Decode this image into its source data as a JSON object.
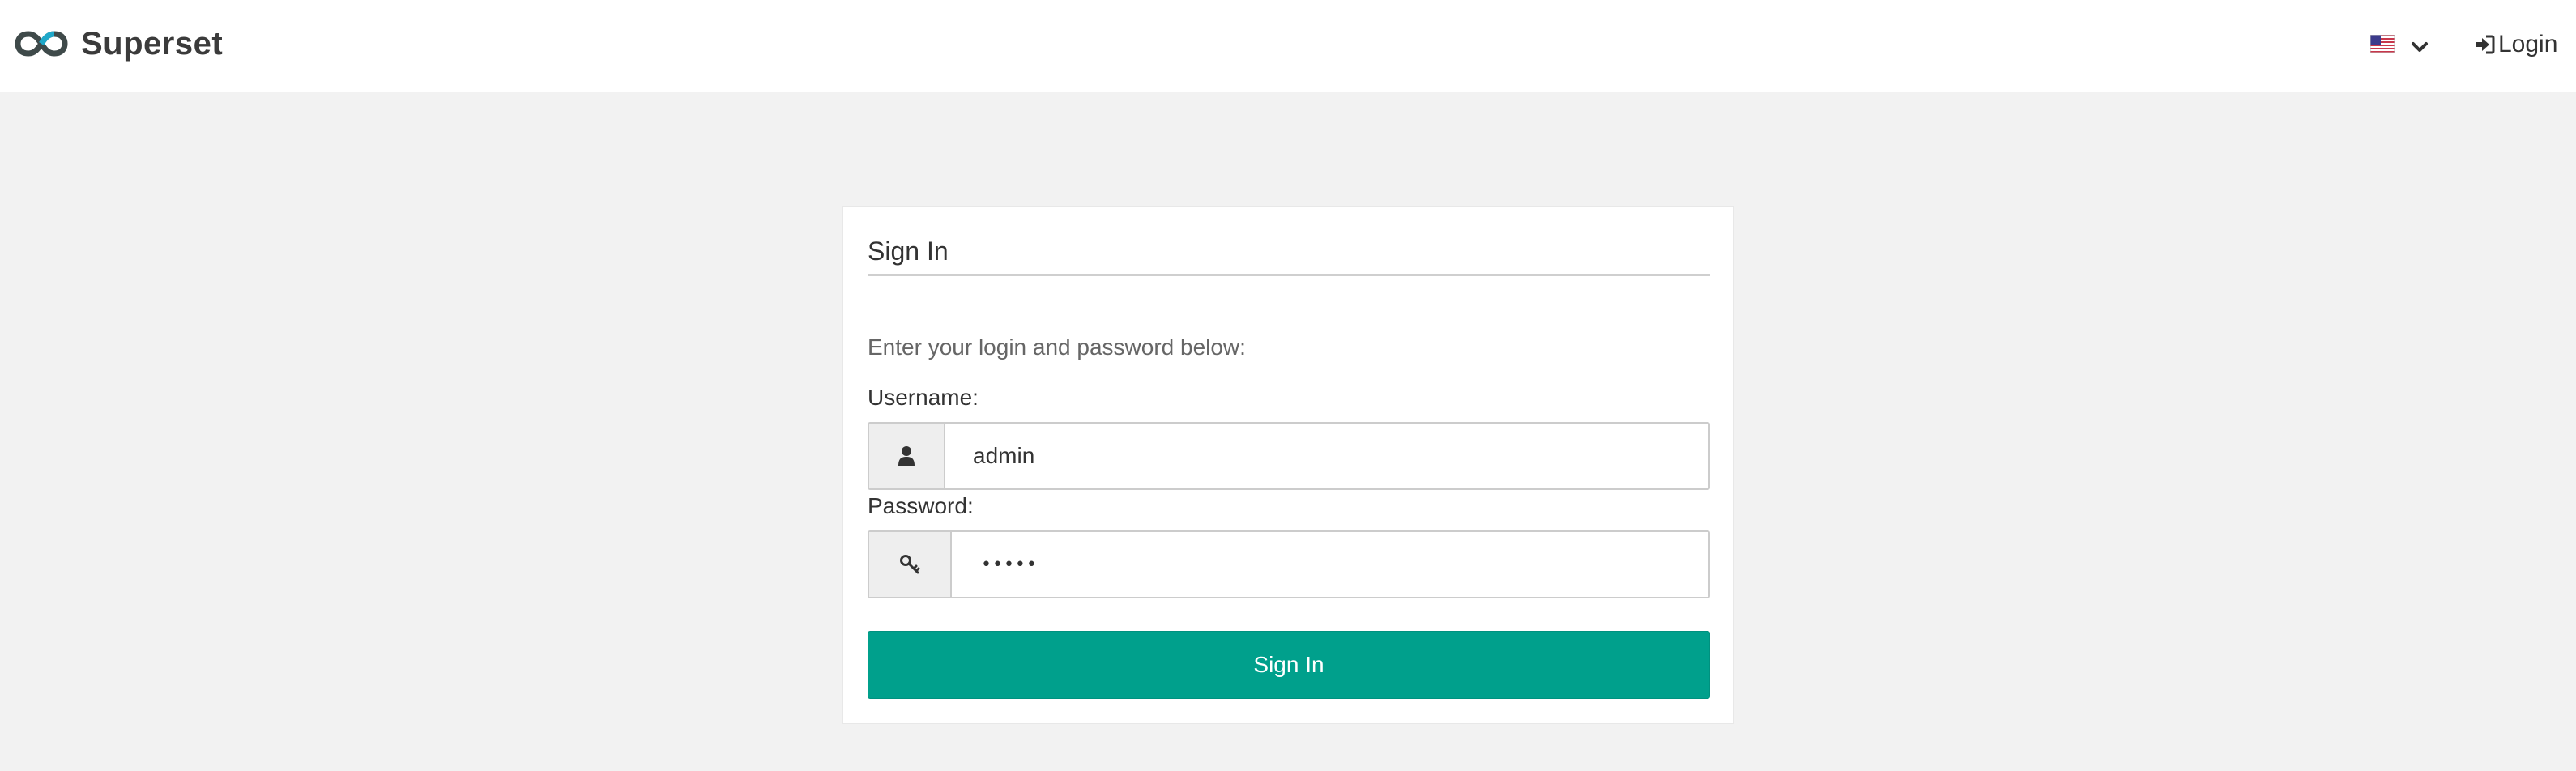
{
  "brand": {
    "name": "Superset",
    "logo_icon": "superset-logo-icon"
  },
  "navbar": {
    "language": {
      "icon": "us-flag-icon",
      "dropdown_icon": "chevron-down-icon"
    },
    "login_label": "Login",
    "login_icon": "sign-in-icon"
  },
  "login_form": {
    "title": "Sign In",
    "intro": "Enter your login and password below:",
    "username": {
      "label": "Username:",
      "value": "admin",
      "icon": "user-icon"
    },
    "password": {
      "label": "Password:",
      "value": "•••••",
      "icon": "key-icon"
    },
    "submit_label": "Sign In"
  },
  "colors": {
    "accent": "#00a08c",
    "page_background": "#f2f2f2",
    "panel_background": "#ffffff"
  }
}
